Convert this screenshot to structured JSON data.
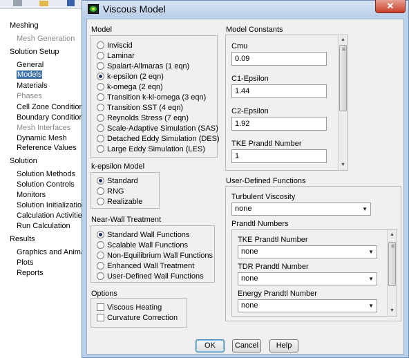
{
  "nav": {
    "items": [
      {
        "label": "Meshing",
        "level": 0,
        "state": "normal"
      },
      {
        "label": "Mesh Generation",
        "level": 1,
        "state": "dim"
      },
      {
        "label": "Solution Setup",
        "level": 0,
        "state": "normal"
      },
      {
        "label": "General",
        "level": 1,
        "state": "normal"
      },
      {
        "label": "Models",
        "level": 1,
        "state": "selected"
      },
      {
        "label": "Materials",
        "level": 1,
        "state": "normal"
      },
      {
        "label": "Phases",
        "level": 1,
        "state": "dim"
      },
      {
        "label": "Cell Zone Conditions",
        "level": 1,
        "state": "normal"
      },
      {
        "label": "Boundary Conditions",
        "level": 1,
        "state": "normal"
      },
      {
        "label": "Mesh Interfaces",
        "level": 1,
        "state": "dim"
      },
      {
        "label": "Dynamic Mesh",
        "level": 1,
        "state": "normal"
      },
      {
        "label": "Reference Values",
        "level": 1,
        "state": "normal"
      },
      {
        "label": "Solution",
        "level": 0,
        "state": "normal"
      },
      {
        "label": "Solution Methods",
        "level": 1,
        "state": "normal"
      },
      {
        "label": "Solution Controls",
        "level": 1,
        "state": "normal"
      },
      {
        "label": "Monitors",
        "level": 1,
        "state": "normal"
      },
      {
        "label": "Solution Initialization",
        "level": 1,
        "state": "normal"
      },
      {
        "label": "Calculation Activities",
        "level": 1,
        "state": "normal"
      },
      {
        "label": "Run Calculation",
        "level": 1,
        "state": "normal"
      },
      {
        "label": "Results",
        "level": 0,
        "state": "normal"
      },
      {
        "label": "Graphics and Animations",
        "level": 1,
        "state": "normal"
      },
      {
        "label": "Plots",
        "level": 1,
        "state": "normal"
      },
      {
        "label": "Reports",
        "level": 1,
        "state": "normal"
      }
    ]
  },
  "dialog": {
    "title": "Viscous Model",
    "close_label": "✕",
    "model": {
      "label": "Model",
      "options": [
        "Inviscid",
        "Laminar",
        "Spalart-Allmaras (1 eqn)",
        "k-epsilon (2 eqn)",
        "k-omega (2 eqn)",
        "Transition k-kl-omega (3 eqn)",
        "Transition SST (4 eqn)",
        "Reynolds Stress (7 eqn)",
        "Scale-Adaptive Simulation (SAS)",
        "Detached Eddy Simulation (DES)",
        "Large Eddy Simulation (LES)"
      ],
      "selected": "k-epsilon (2 eqn)"
    },
    "ke_model": {
      "label": "k-epsilon Model",
      "options": [
        "Standard",
        "RNG",
        "Realizable"
      ],
      "selected": "Standard"
    },
    "near_wall": {
      "label": "Near-Wall Treatment",
      "options": [
        "Standard Wall Functions",
        "Scalable Wall Functions",
        "Non-Equilibrium Wall Functions",
        "Enhanced Wall Treatment",
        "User-Defined Wall Functions"
      ],
      "selected": "Standard Wall Functions"
    },
    "options": {
      "label": "Options",
      "items": [
        {
          "label": "Viscous Heating",
          "checked": false
        },
        {
          "label": "Curvature Correction",
          "checked": false
        }
      ]
    },
    "constants": {
      "label": "Model Constants",
      "fields": [
        {
          "label": "Cmu",
          "value": "0.09"
        },
        {
          "label": "C1-Epsilon",
          "value": "1.44"
        },
        {
          "label": "C2-Epsilon",
          "value": "1.92"
        },
        {
          "label": "TKE Prandtl Number",
          "value": "1"
        }
      ]
    },
    "udf": {
      "label": "User-Defined Functions",
      "turbulent_viscosity_label": "Turbulent Viscosity",
      "turbulent_viscosity_value": "none",
      "prandtl_label": "Prandtl Numbers",
      "prandtl": [
        {
          "label": "TKE Prandtl Number",
          "value": "none"
        },
        {
          "label": "TDR Prandtl Number",
          "value": "none"
        },
        {
          "label": "Energy Prandtl Number",
          "value": "none"
        }
      ]
    },
    "buttons": {
      "ok": "OK",
      "cancel": "Cancel",
      "help": "Help"
    }
  }
}
